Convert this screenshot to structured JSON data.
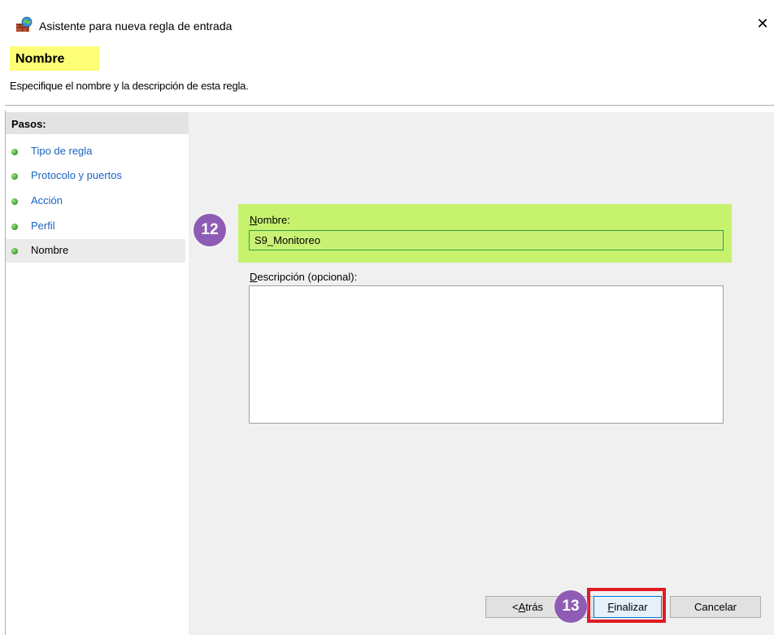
{
  "window": {
    "title": "Asistente para nueva regla de entrada",
    "close_glyph": "✕",
    "icon": "firewall-icon"
  },
  "header": {
    "step_title": "Nombre",
    "description": "Especifique el nombre y la descripción de esta regla."
  },
  "steps": {
    "header": "Pasos:",
    "items": [
      {
        "label": "Tipo de regla",
        "current": false
      },
      {
        "label": "Protocolo y puertos",
        "current": false
      },
      {
        "label": "Acción",
        "current": false
      },
      {
        "label": "Perfil",
        "current": false
      },
      {
        "label": "Nombre",
        "current": true
      }
    ]
  },
  "form": {
    "name_label_u": "N",
    "name_label_rest": "ombre:",
    "name_value": "S9_Monitoreo",
    "desc_label_u": "D",
    "desc_label_rest": "escripción (opcional):",
    "desc_value": ""
  },
  "buttons": {
    "back_prefix": "< ",
    "back_u": "A",
    "back_rest": "trás",
    "finish_u": "F",
    "finish_rest": "inalizar",
    "cancel": "Cancelar"
  },
  "callouts": {
    "name_step": "12",
    "finish_step": "13"
  },
  "colors": {
    "highlight_yellow": "#fdfd76",
    "highlight_green": "#c6f26e",
    "callout_purple": "#8e5cb5",
    "frame_red": "#e01b24",
    "link_blue": "#1a63c2",
    "step_dot_green": "#4aa63a"
  }
}
